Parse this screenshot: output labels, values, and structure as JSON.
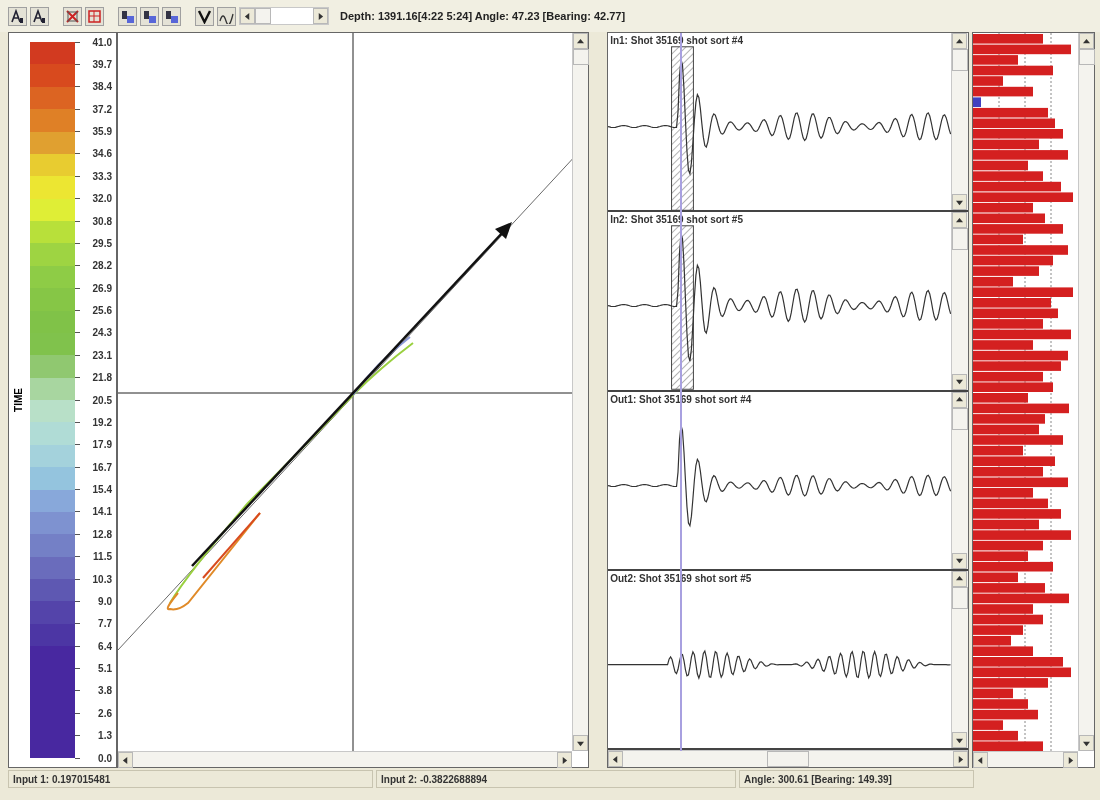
{
  "toolbar": {
    "readout": "Depth: 1391.16[4:22 5:24] Angle: 47.23 [Bearing: 42.77]"
  },
  "colorbar": {
    "title": "TIME",
    "ticks": [
      "41.0",
      "39.7",
      "38.4",
      "37.2",
      "35.9",
      "34.6",
      "33.3",
      "32.0",
      "30.8",
      "29.5",
      "28.2",
      "26.9",
      "25.6",
      "24.3",
      "23.1",
      "21.8",
      "20.5",
      "19.2",
      "17.9",
      "16.7",
      "15.4",
      "14.1",
      "12.8",
      "11.5",
      "10.3",
      "9.0",
      "7.7",
      "6.4",
      "5.1",
      "3.8",
      "2.6",
      "1.3",
      "0.0"
    ],
    "bands": [
      {
        "color": "#d23a20"
      },
      {
        "color": "#d84a1e"
      },
      {
        "color": "#dc6422"
      },
      {
        "color": "#df8026"
      },
      {
        "color": "#e0a030"
      },
      {
        "color": "#e8cc30"
      },
      {
        "color": "#ece632"
      },
      {
        "color": "#dfee36"
      },
      {
        "color": "#b8e03a"
      },
      {
        "color": "#9ed442"
      },
      {
        "color": "#8ecc46"
      },
      {
        "color": "#86c646"
      },
      {
        "color": "#80c248"
      },
      {
        "color": "#80c24c"
      },
      {
        "color": "#90c870"
      },
      {
        "color": "#a8d6a0"
      },
      {
        "color": "#b8e0c8"
      },
      {
        "color": "#b0dcd6"
      },
      {
        "color": "#a4d2dc"
      },
      {
        "color": "#94c4de"
      },
      {
        "color": "#88a8da"
      },
      {
        "color": "#7e92d0"
      },
      {
        "color": "#7480c6"
      },
      {
        "color": "#6a6cbc"
      },
      {
        "color": "#5e58b2"
      },
      {
        "color": "#5444aa"
      },
      {
        "color": "#4c36a4"
      },
      {
        "color": "#4828a0"
      },
      {
        "color": "#4828a0"
      },
      {
        "color": "#4828a0"
      },
      {
        "color": "#4828a0"
      },
      {
        "color": "#4828a0"
      }
    ]
  },
  "traces": [
    {
      "title": "In1: Shot 35169 shot sort #4",
      "hatched": true
    },
    {
      "title": "In2: Shot 35169 shot sort #5",
      "hatched": true
    },
    {
      "title": "Out1: Shot 35169 shot sort #4",
      "hatched": false
    },
    {
      "title": "Out2: Shot 35169 shot sort #5",
      "hatched": false
    }
  ],
  "status_bar": [
    "Input 1: 0.197015481",
    "Input 2: -0.3822688894",
    "Angle: 300.61 [Bearing: 149.39]"
  ]
}
